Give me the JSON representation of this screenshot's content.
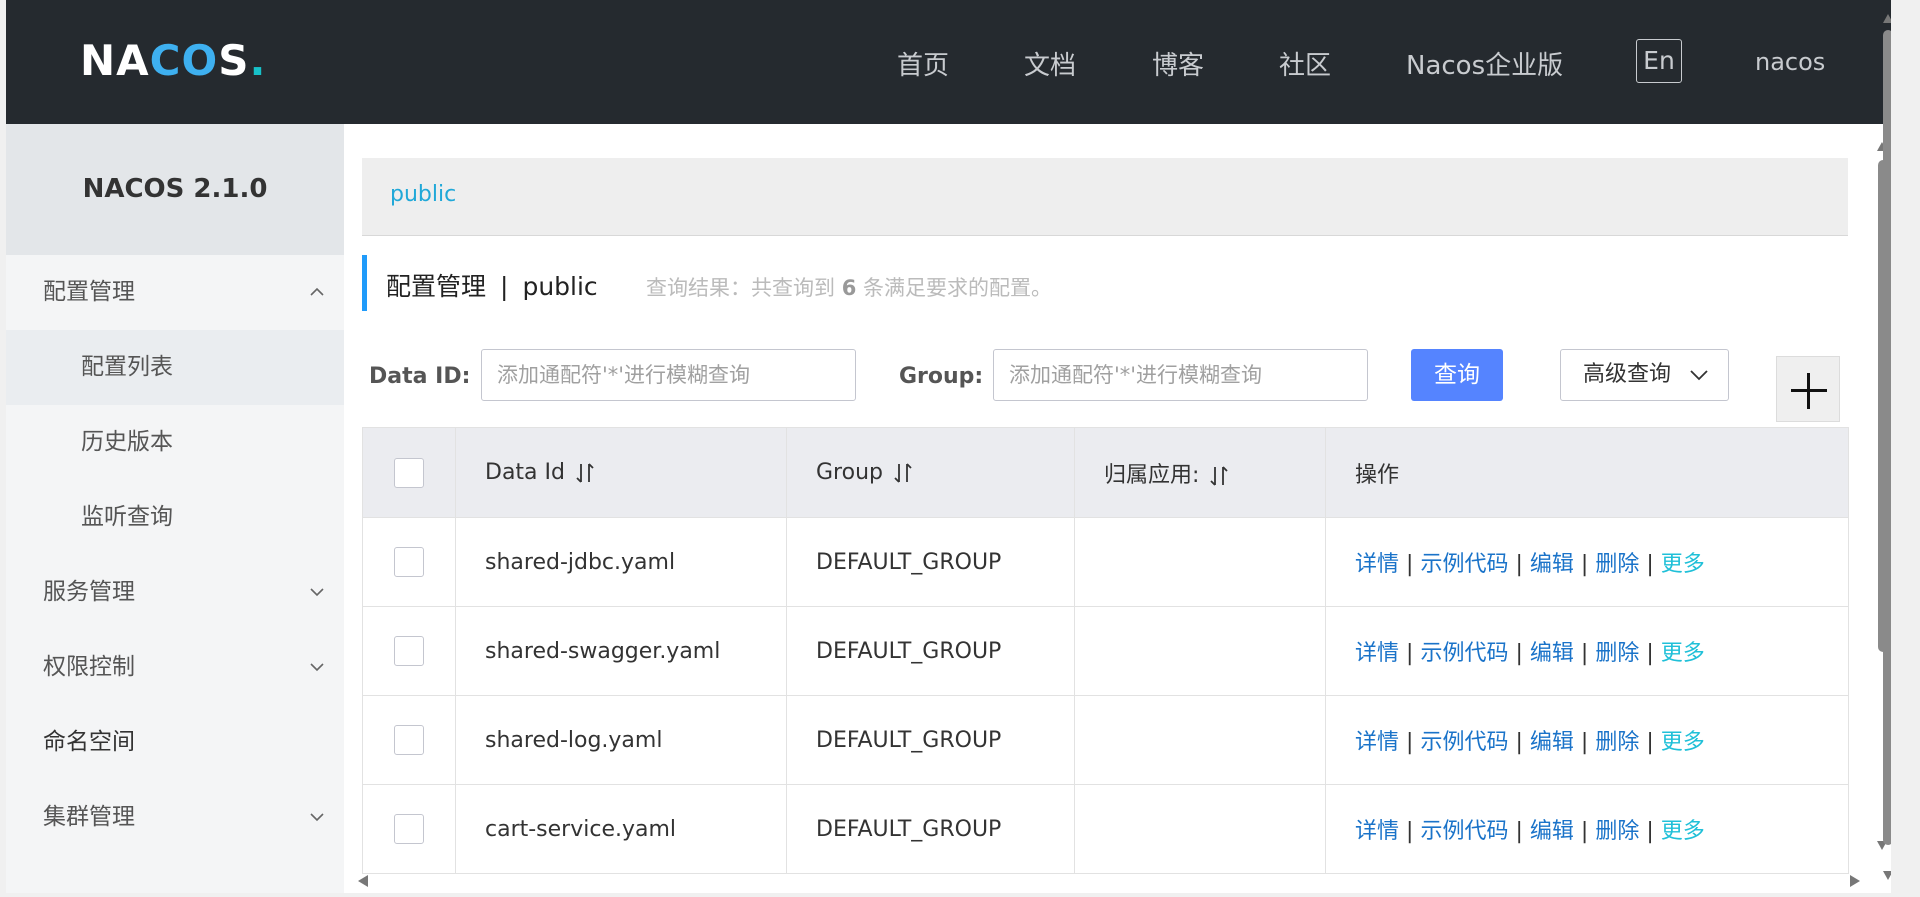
{
  "header": {
    "logo": "NACOS.",
    "nav": [
      "首页",
      "文档",
      "博客",
      "社区",
      "Nacos企业版"
    ],
    "lang_button": "En",
    "user": "nacos"
  },
  "sidebar": {
    "title": "NACOS 2.1.0",
    "items": [
      {
        "label": "配置管理",
        "expanded": true
      },
      {
        "label": "配置列表",
        "sub": true,
        "active": true
      },
      {
        "label": "历史版本",
        "sub": true
      },
      {
        "label": "监听查询",
        "sub": true
      },
      {
        "label": "服务管理",
        "expanded": false
      },
      {
        "label": "权限控制",
        "expanded": false
      },
      {
        "label": "命名空间"
      },
      {
        "label": "集群管理",
        "expanded": false
      }
    ]
  },
  "main": {
    "namespace_tab": "public",
    "page_title": "配置管理",
    "title_separator": "|",
    "title_namespace": "public",
    "result_prefix": "查询结果：共查询到",
    "result_count": "6",
    "result_suffix": "条满足要求的配置。",
    "filters": {
      "data_id_label": "Data ID:",
      "data_id_placeholder": "添加通配符'*'进行模糊查询",
      "group_label": "Group:",
      "group_placeholder": "添加通配符'*'进行模糊查询",
      "query_button": "查询",
      "advanced_button": "高级查询"
    },
    "table": {
      "columns": [
        "Data Id",
        "Group",
        "归属应用:",
        "操作"
      ],
      "rows": [
        {
          "data_id": "shared-jdbc.yaml",
          "group": "DEFAULT_GROUP",
          "app": ""
        },
        {
          "data_id": "shared-swagger.yaml",
          "group": "DEFAULT_GROUP",
          "app": ""
        },
        {
          "data_id": "shared-log.yaml",
          "group": "DEFAULT_GROUP",
          "app": ""
        },
        {
          "data_id": "cart-service.yaml",
          "group": "DEFAULT_GROUP",
          "app": ""
        }
      ],
      "actions": [
        "详情",
        "示例代码",
        "编辑",
        "删除",
        "更多"
      ]
    }
  },
  "colors": {
    "header_bg": "#252a2f",
    "primary": "#5584ff",
    "link": "#1a73c9",
    "more_link": "#20c0d8",
    "namespace_link": "#20a8d8"
  }
}
